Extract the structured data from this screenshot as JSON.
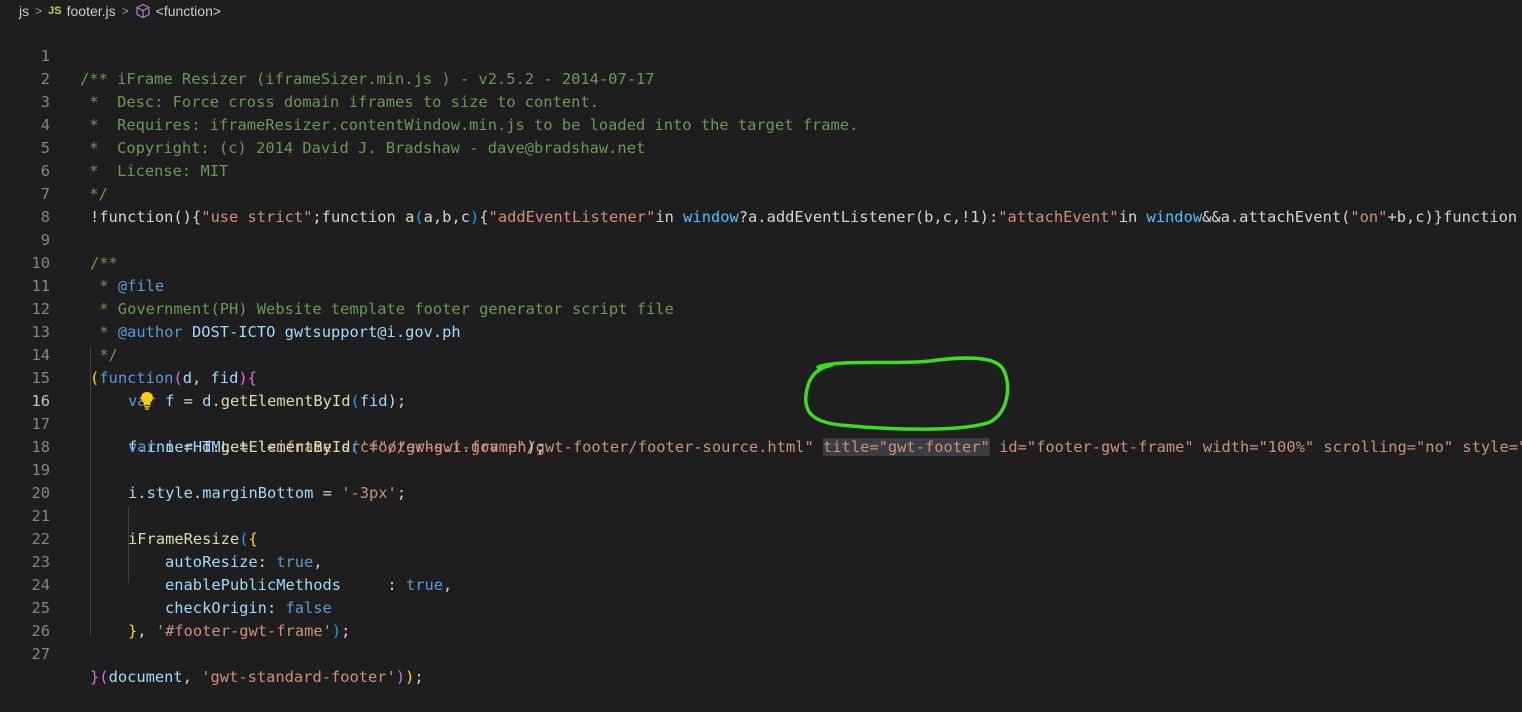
{
  "breadcrumb": {
    "folder": "js",
    "file_badge": "JS",
    "file": "footer.js",
    "symbol": "<function>"
  },
  "icons": {
    "separator": "chevron-right-icon",
    "symbol": "cube-icon",
    "lightbulb": "lightbulb-icon"
  },
  "editor": {
    "active_line": 16,
    "lines": {
      "l1": "/** iFrame Resizer (iframeSizer.min.js ) - v2.5.2 - 2014-07-17",
      "l2": " *  Desc: Force cross domain iframes to size to content.",
      "l3": " *  Requires: iframeResizer.contentWindow.min.js to be loaded into the target frame.",
      "l4": " *  Copyright: (c) 2014 David J. Bradshaw - dave@bradshaw.net",
      "l5": " *  License: MIT",
      "l6": " */",
      "l7": {
        "a": "!function(){",
        "b": "\"use strict\"",
        "c": ";function ",
        "d": "a",
        "e": "(",
        "f": "a,b,c",
        "g": ")",
        "h": "{",
        "i": "\"addEventListener\"",
        "j": "in ",
        "k": "window",
        "l": "?a.addEventListener(b,c,!1):",
        "m": "\"attachEvent\"",
        "n": "in ",
        "o": "window",
        "p": "&&a.attachEvent(",
        "q": "\"on\"",
        "r": "+b,c)}function"
      },
      "l9": "/**",
      "l10": {
        "a": " * ",
        "b": "@file"
      },
      "l11": " * Government(PH) Website template footer generator script file",
      "l12": {
        "a": " * ",
        "b": "@author",
        "c": " DOST-ICTO ",
        "d": "gwtsupport@i.gov.ph"
      },
      "l13": " */",
      "l14": {
        "a": "(",
        "b": "function",
        "c": "(",
        "d": "d",
        "e": ", ",
        "f": "fid",
        "g": ")",
        "h": "{"
      },
      "l15": {
        "a": "var ",
        "b": "f",
        "c": " = ",
        "d": "d",
        "e": ".",
        "f": "getElementById",
        "g": "(",
        "h": "fid",
        "i": ");"
      },
      "l16": {
        "a": "f",
        "b": ".",
        "c": "innerHTML",
        "d": " = ",
        "e": "'<iframe src=\"//gwhs.i.gov.ph/gwt-footer/footer-source.html\" ",
        "f": "title=\"gwt-footer\"",
        "g": " id=\"footer-gwt-frame\" width=\"100%\" scrolling=\"no\" style=\""
      },
      "l17": {
        "a": "var ",
        "b": "i",
        "c": " = ",
        "d": "d",
        "e": ".",
        "f": "getElementById",
        "g": "(",
        "h": "'footer-gwt-frame'",
        "i": ");"
      },
      "l19": {
        "a": "i",
        "b": ".",
        "c": "style",
        "d": ".",
        "e": "marginBottom",
        "f": " = ",
        "g": "'-3px'",
        "h": ";"
      },
      "l21": {
        "a": "iFrameResize",
        "b": "(",
        "c": "{"
      },
      "l22": {
        "a": "autoResize",
        "b": ": ",
        "c": "true",
        "d": ","
      },
      "l23": {
        "a": "enablePublicMethods",
        "b": "     : ",
        "c": "true",
        "d": ","
      },
      "l24": {
        "a": "checkOrigin",
        "b": ": ",
        "c": "false"
      },
      "l25": {
        "a": "}",
        "b": ", ",
        "c": "'#footer-gwt-frame'",
        "d": ")",
        "e": ";"
      },
      "l27": {
        "a": "}",
        "b": "(",
        "c": "document",
        "d": ", ",
        "e": "'gwt-standard-footer'",
        "f": ")",
        "g": ")",
        "h": ";"
      }
    }
  },
  "colors": {
    "background": "#1e1e1e",
    "comment": "#6a9955",
    "keyword": "#569cd6",
    "string": "#ce9178",
    "function": "#dcdcaa",
    "property": "#9cdcfe",
    "annotation_circle": "#3cdc1e"
  }
}
